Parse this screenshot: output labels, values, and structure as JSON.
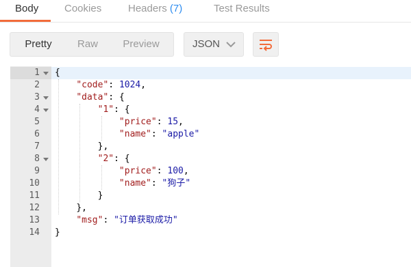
{
  "tabs": {
    "body": "Body",
    "cookies": "Cookies",
    "headers": "Headers",
    "headers_count": "(7)",
    "test_results": "Test Results"
  },
  "toolbar": {
    "pretty": "Pretty",
    "raw": "Raw",
    "preview": "Preview",
    "format": "JSON",
    "wrap_icon": "wrap-lines-icon"
  },
  "colors": {
    "accent": "#f26b3a",
    "count": "#2d8cf0",
    "key": "#a11d1d",
    "value": "#1a1aa6"
  },
  "editor": {
    "lines": [
      {
        "n": "1",
        "fold": true,
        "text": "{"
      },
      {
        "n": "2",
        "fold": false,
        "text": "    \"code\": 1024,"
      },
      {
        "n": "3",
        "fold": true,
        "text": "    \"data\": {"
      },
      {
        "n": "4",
        "fold": true,
        "text": "        \"1\": {"
      },
      {
        "n": "5",
        "fold": false,
        "text": "            \"price\": 15,"
      },
      {
        "n": "6",
        "fold": false,
        "text": "            \"name\": \"apple\""
      },
      {
        "n": "7",
        "fold": false,
        "text": "        },"
      },
      {
        "n": "8",
        "fold": true,
        "text": "        \"2\": {"
      },
      {
        "n": "9",
        "fold": false,
        "text": "            \"price\": 100,"
      },
      {
        "n": "10",
        "fold": false,
        "text": "            \"name\": \"狗子\""
      },
      {
        "n": "11",
        "fold": false,
        "text": "        }"
      },
      {
        "n": "12",
        "fold": false,
        "text": "    },"
      },
      {
        "n": "13",
        "fold": false,
        "text": "    \"msg\": \"订单获取成功\""
      },
      {
        "n": "14",
        "fold": false,
        "text": "}"
      }
    ]
  }
}
